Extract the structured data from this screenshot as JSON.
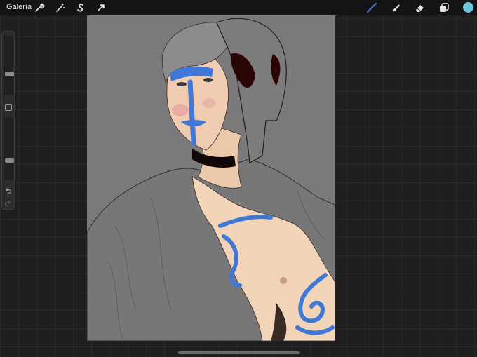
{
  "topbar": {
    "gallery_label": "Galería",
    "actions": [
      {
        "icon": "wrench-icon"
      },
      {
        "icon": "magic-wand-icon"
      },
      {
        "icon": "selection-s-icon"
      },
      {
        "icon": "transform-arrow-icon"
      }
    ],
    "tools": [
      {
        "icon": "brush-icon",
        "active": true
      },
      {
        "icon": "smudge-icon"
      },
      {
        "icon": "eraser-icon"
      },
      {
        "icon": "layers-icon"
      }
    ],
    "current_color": "#6ec3d6"
  },
  "sidebar": {
    "brush_size_level": 0.35,
    "opacity_level": 0.3
  },
  "colors": {
    "accent_blue": "#3f78d6",
    "canvas_bg": "#7a7a7a"
  }
}
